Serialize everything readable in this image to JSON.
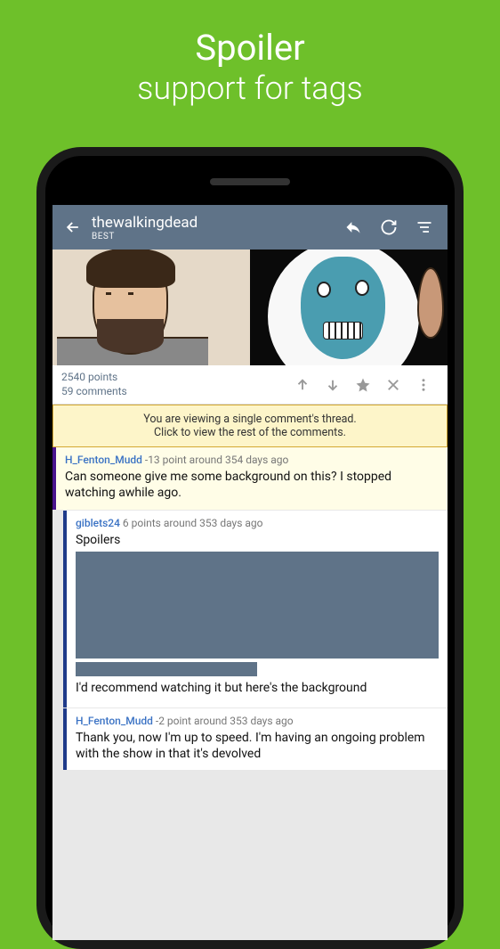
{
  "promo": {
    "line1": "Spoiler",
    "line2": "support for tags"
  },
  "appbar": {
    "title": "thewalkingdead",
    "subtitle": "BEST"
  },
  "post": {
    "points": "2540 points",
    "comments": "59 comments"
  },
  "notice": {
    "line1": "You are viewing a single comment's thread.",
    "line2": "Click to view the rest of the comments."
  },
  "comments": [
    {
      "user": "H_Fenton_Mudd",
      "meta": "-13 point around 354 days ago",
      "body": "Can someone give me some background on this? I stopped watching awhile ago."
    },
    {
      "user": "giblets24",
      "meta": "6 points around 353 days ago",
      "body_intro": "Spoilers",
      "body_after": "I'd recommend watching it but here's the background"
    },
    {
      "user": "H_Fenton_Mudd",
      "meta": "-2 point around 353 days ago",
      "body": "Thank you, now I'm up to speed. I'm having an ongoing problem with the show in that it's devolved"
    }
  ]
}
